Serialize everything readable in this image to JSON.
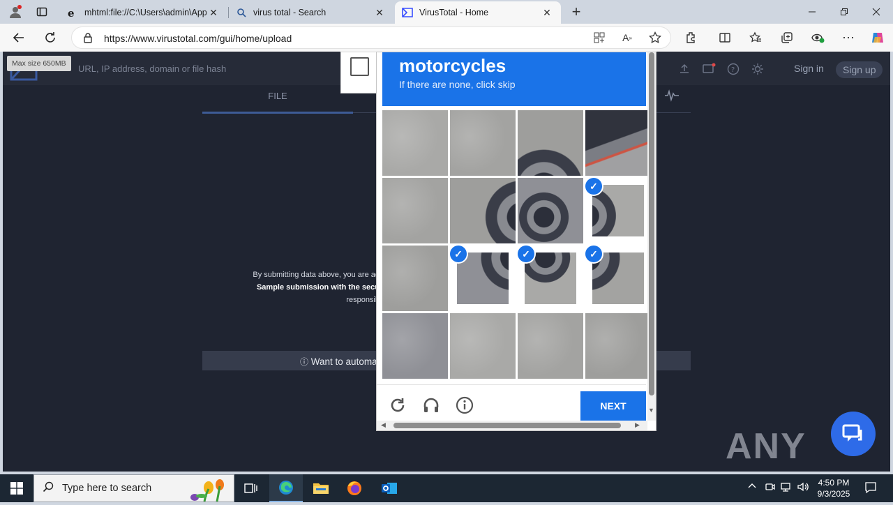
{
  "browser": {
    "tabs": [
      {
        "label": "mhtml:file://C:\\Users\\admin\\AppD",
        "icon": "ie-icon"
      },
      {
        "label": "virus total - Search",
        "icon": "search-icon"
      },
      {
        "label": "VirusTotal - Home",
        "icon": "virustotal-icon"
      }
    ],
    "new_tab": "+",
    "url": "https://www.virustotal.com/gui/home/upload"
  },
  "vt": {
    "max_size": "Max size 650MB",
    "search_placeholder": "URL, IP address, domain or file hash",
    "sign_in": "Sign in",
    "sign_up": "Sign up",
    "file_tab": "FILE",
    "disclaimer_1": "By submitting data above, you are ag",
    "disclaimer_2": "Sample submission with the secu",
    "disclaimer_3": "responsib",
    "want_automate": "Want to automa"
  },
  "captcha": {
    "title": "motorcycles",
    "subtitle": "If there are none, click skip",
    "next_label": "NEXT",
    "selected_cells": [
      7,
      9,
      10,
      11
    ]
  },
  "watermark": "ANY RUN",
  "taskbar": {
    "search_placeholder": "Type here to search",
    "time": "4:50 PM",
    "date": "9/3/2025"
  },
  "colors": {
    "captcha_blue": "#1a73e8",
    "vt_dark": "#1f2431"
  }
}
